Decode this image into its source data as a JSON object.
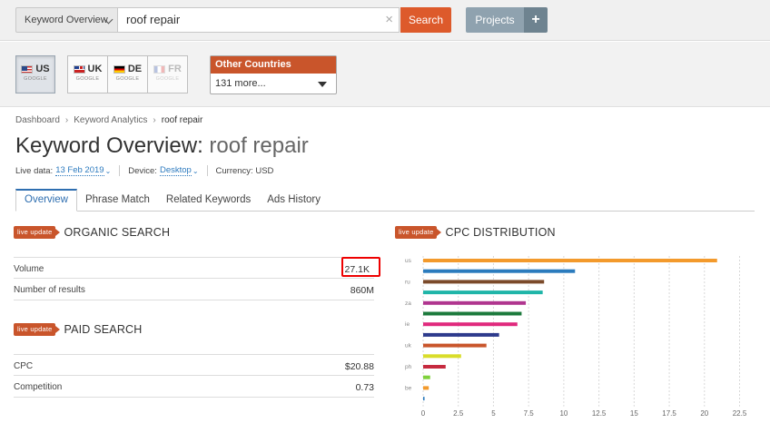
{
  "topbar": {
    "tool_select": "Keyword Overview",
    "search_value": "roof repair",
    "clear_glyph": "×",
    "search_label": "Search",
    "projects_label": "Projects",
    "plus_glyph": "+"
  },
  "databases": {
    "items": [
      {
        "code": "US",
        "engine": "GOOGLE",
        "flag": "us"
      },
      {
        "code": "UK",
        "engine": "GOOGLE",
        "flag": "uk"
      },
      {
        "code": "DE",
        "engine": "GOOGLE",
        "flag": "de"
      },
      {
        "code": "FR",
        "engine": "GOOGLE",
        "flag": "fr"
      }
    ],
    "other_label": "Other Countries",
    "other_value": "131 more..."
  },
  "breadcrumb": {
    "items": [
      "Dashboard",
      "Keyword Analytics",
      "roof repair"
    ],
    "sep": "›"
  },
  "title": {
    "prefix": "Keyword Overview:",
    "keyword": "roof repair"
  },
  "meta": {
    "live_label": "Live data:",
    "live_value": "13 Feb 2019",
    "device_label": "Device:",
    "device_value": "Desktop",
    "currency": "Currency: USD"
  },
  "tabs": [
    "Overview",
    "Phrase Match",
    "Related Keywords",
    "Ads History"
  ],
  "organic": {
    "badge": "live update",
    "title": "ORGANIC SEARCH",
    "rows": [
      {
        "label": "Volume",
        "value": "27.1K"
      },
      {
        "label": "Number of results",
        "value": "860M"
      }
    ]
  },
  "paid": {
    "badge": "live update",
    "title": "PAID SEARCH",
    "rows": [
      {
        "label": "CPC",
        "value": "$20.88"
      },
      {
        "label": "Competition",
        "value": "0.73"
      }
    ]
  },
  "cpc": {
    "badge": "live update",
    "title": "CPC DISTRIBUTION"
  },
  "chart_data": {
    "type": "bar",
    "orientation": "horizontal",
    "title": "CPC DISTRIBUTION",
    "categories": [
      "us",
      "",
      "ru",
      "",
      "za",
      "",
      "ie",
      "",
      "uk",
      "",
      "ph",
      "",
      "be",
      ""
    ],
    "values": [
      20.9,
      10.8,
      8.6,
      8.5,
      7.3,
      7.0,
      6.7,
      5.4,
      4.5,
      2.7,
      1.6,
      0.5,
      0.4,
      0.1
    ],
    "colors": [
      "#f39a2c",
      "#2b7bbd",
      "#7b4a2a",
      "#1fb5a8",
      "#b0358f",
      "#1c7a3c",
      "#e0297d",
      "#2d3a8c",
      "#c9552b",
      "#d9dd2a",
      "#c62a3f",
      "#7fd13b",
      "#f39a2c",
      "#2b7bbd"
    ],
    "xlim": [
      0,
      23.5
    ],
    "xticks": [
      "0",
      "2.5",
      "5",
      "7.5",
      "10",
      "12.5",
      "15",
      "17.5",
      "20",
      "22.5"
    ],
    "grid": true
  }
}
